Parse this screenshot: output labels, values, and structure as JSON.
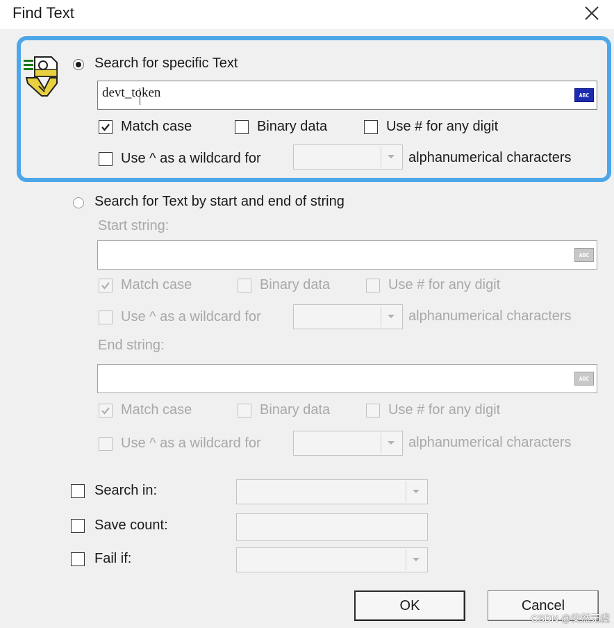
{
  "window": {
    "title": "Find Text"
  },
  "specific": {
    "radio_label": "Search for specific Text",
    "selected": true,
    "text_value": "devt_token",
    "abc_icon_label": "ABC",
    "match_case_label": "Match case",
    "match_case_checked": true,
    "binary_data_label": "Binary data",
    "binary_data_checked": false,
    "digit_label": "Use # for any digit",
    "digit_checked": false,
    "wildcard_label": "Use ^ as a wildcard for",
    "wildcard_checked": false,
    "wildcard_select_value": "",
    "alnum_label": "alphanumerical characters"
  },
  "startend": {
    "radio_label": "Search for Text by start and end of string",
    "selected": false,
    "start_label": "Start string:",
    "start_value": "",
    "end_label": "End string:",
    "end_value": "",
    "abc_icon_label": "ABC",
    "match_case_label": "Match case",
    "binary_data_label": "Binary data",
    "digit_label": "Use # for any digit",
    "wildcard_label": "Use ^ as a wildcard for",
    "alnum_label": "alphanumerical characters"
  },
  "options": {
    "search_in_label": "Search in:",
    "save_count_label": "Save count:",
    "fail_if_label": "Fail if:"
  },
  "buttons": {
    "ok": "OK",
    "cancel": "Cancel"
  },
  "watermark": "CSDN @安然无虞",
  "colors": {
    "highlight_border": "#4da6e8",
    "abc_active": "#1c2bb0",
    "disabled_text": "#a8a8a8"
  },
  "icons": {
    "close": "close-icon",
    "find_text": "find-text-icon",
    "abc": "abc-icon",
    "check": "checkmark-icon",
    "dropdown": "chevron-down-icon"
  }
}
